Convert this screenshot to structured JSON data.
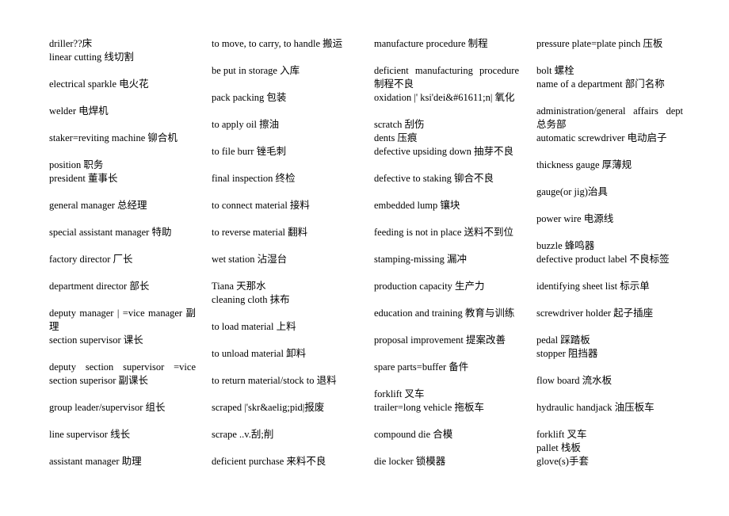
{
  "document": {
    "type": "glossary",
    "columns": [
      {
        "entries": [
          {
            "row": 0,
            "text": "driller??床"
          },
          {
            "row": 1,
            "text": "linear cutting 线切割"
          },
          {
            "row": 3,
            "text": "electrical sparkle 电火花"
          },
          {
            "row": 5,
            "text": "welder 电焊机"
          },
          {
            "row": 7,
            "text": "staker=reviting machine 铆合机"
          },
          {
            "row": 9,
            "text": "position 职务"
          },
          {
            "row": 10,
            "text": "president 董事长"
          },
          {
            "row": 12,
            "text": "general manager 总经理"
          },
          {
            "row": 14,
            "text": "special assistant manager 特助"
          },
          {
            "row": 16,
            "text": "factory director 厂长"
          },
          {
            "row": 18,
            "text": "department director 部长"
          },
          {
            "row": 20,
            "text": "deputy manager | =vice manager 副理"
          },
          {
            "row": 22,
            "text": "section supervisor 课长"
          },
          {
            "row": 24,
            "text": "deputy section supervisor =vice section superisor 副课长"
          },
          {
            "row": 27,
            "text": "group leader/supervisor 组长"
          },
          {
            "row": 29,
            "text": "line supervisor 线长"
          },
          {
            "row": 31,
            "text": "assistant manager 助理"
          }
        ]
      },
      {
        "entries": [
          {
            "row": 0,
            "text": "to move, to carry, to handle 搬运"
          },
          {
            "row": 2,
            "text": "be put in storage 入库"
          },
          {
            "row": 4,
            "text": "pack packing 包装"
          },
          {
            "row": 6,
            "text": "to apply oil 擦油"
          },
          {
            "row": 8,
            "text": "to file burr  锉毛刺"
          },
          {
            "row": 10,
            "text": "final inspection 终检"
          },
          {
            "row": 12,
            "text": "to connect material 接料"
          },
          {
            "row": 14,
            "text": "to reverse material  翻料"
          },
          {
            "row": 16,
            "text": "wet station 沾湿台"
          },
          {
            "row": 18,
            "text": "Tiana 天那水"
          },
          {
            "row": 19,
            "text": "cleaning cloth 抹布"
          },
          {
            "row": 21,
            "text": "to load material 上料"
          },
          {
            "row": 23,
            "text": "to unload material 卸料"
          },
          {
            "row": 25,
            "text": "to return material/stock to 退料"
          },
          {
            "row": 27,
            "text": "scraped |'skr&aelig;pid|报废"
          },
          {
            "row": 29,
            "text": "scrape ..v.刮;削"
          },
          {
            "row": 31,
            "text": "deficient purchase 来料不良"
          }
        ]
      },
      {
        "entries": [
          {
            "row": 0,
            "text": "manufacture procedure 制程"
          },
          {
            "row": 2,
            "text": "deficient manufacturing procedure 制程不良"
          },
          {
            "row": 4,
            "text": "oxidation |' ksi'dei&#61611;n| 氧化"
          },
          {
            "row": 6,
            "text": "scratch 刮伤"
          },
          {
            "row": 7,
            "text": "dents 压痕"
          },
          {
            "row": 8,
            "text": "defective upsiding down 抽芽不良"
          },
          {
            "row": 10,
            "text": "defective to staking 铆合不良"
          },
          {
            "row": 12,
            "text": "embedded lump 镶块"
          },
          {
            "row": 14,
            "text": "feeding is not in place 送料不到位"
          },
          {
            "row": 16,
            "text": "stamping-missing 漏冲"
          },
          {
            "row": 18,
            "text": "production capacity 生产力"
          },
          {
            "row": 20,
            "text": "education and training 教育与训练"
          },
          {
            "row": 22,
            "text": "proposal improvement 提案改善"
          },
          {
            "row": 24,
            "text": "spare parts=buffer 备件"
          },
          {
            "row": 26,
            "text": "forklift 叉车"
          },
          {
            "row": 27,
            "text": "trailer=long vehicle 拖板车"
          },
          {
            "row": 29,
            "text": "compound die 合模"
          },
          {
            "row": 31,
            "text": "die locker 锁模器"
          }
        ]
      },
      {
        "entries": [
          {
            "row": 0,
            "text": "pressure plate=plate pinch 压板"
          },
          {
            "row": 2,
            "text": "bolt 螺栓"
          },
          {
            "row": 3,
            "text": "name of a department 部门名称"
          },
          {
            "row": 5,
            "text": "administration/general affairs dept 总务部"
          },
          {
            "row": 7,
            "text": "automatic screwdriver 电动启子"
          },
          {
            "row": 9,
            "text": "thickness gauge 厚薄规"
          },
          {
            "row": 11,
            "text": "gauge(or jig)治具"
          },
          {
            "row": 13,
            "text": "power wire 电源线"
          },
          {
            "row": 15,
            "text": "buzzle 蜂鸣器"
          },
          {
            "row": 16,
            "text": "defective product label 不良标签"
          },
          {
            "row": 18,
            "text": "identifying sheet list 标示单"
          },
          {
            "row": 20,
            "text": "screwdriver holder 起子插座"
          },
          {
            "row": 22,
            "text": "pedal 踩踏板"
          },
          {
            "row": 23,
            "text": "stopper 阻挡器"
          },
          {
            "row": 25,
            "text": "flow board 流水板"
          },
          {
            "row": 27,
            "text": "hydraulic handjack 油压板车"
          },
          {
            "row": 29,
            "text": "forklift 叉车"
          },
          {
            "row": 30,
            "text": "pallet 栈板"
          },
          {
            "row": 31,
            "text": "glove(s)手套"
          }
        ]
      }
    ]
  }
}
